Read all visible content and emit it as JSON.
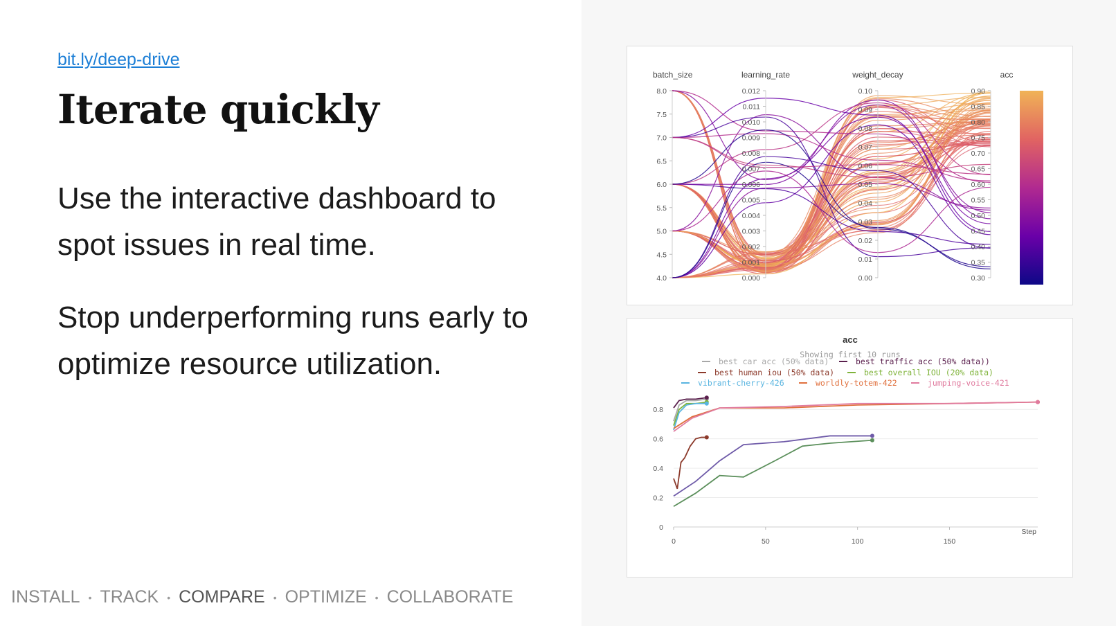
{
  "slide": {
    "link": "bit.ly/deep-drive",
    "title": "Iterate quickly",
    "paragraph1": "Use the interactive dashboard to spot issues in real time.",
    "paragraph2": "Stop underperforming runs early to optimize resource utilization."
  },
  "nav": {
    "items": [
      "INSTALL",
      "TRACK",
      "COMPARE",
      "OPTIMIZE",
      "COLLABORATE"
    ],
    "active": "COMPARE",
    "separator": "•"
  },
  "colors": {
    "link": "#1d7fd6",
    "highlight": "#fde7b8",
    "runs_orange": "#f0b356",
    "runs_purple": "#4a2f9e"
  },
  "chart_data": [
    {
      "type": "parallel-coordinates",
      "axes": [
        {
          "name": "batch_size",
          "ticks": [
            "8.0",
            "7.5",
            "7.0",
            "6.5",
            "6.0",
            "5.5",
            "5.0",
            "4.5",
            "4.0"
          ]
        },
        {
          "name": "learning_rate",
          "ticks": [
            "0.012",
            "0.011",
            "0.010",
            "0.009",
            "0.008",
            "0.007",
            "0.006",
            "0.005",
            "0.004",
            "0.003",
            "0.002",
            "0.001",
            "0.000"
          ]
        },
        {
          "name": "weight_decay",
          "ticks": [
            "0.10",
            "0.09",
            "0.08",
            "0.07",
            "0.06",
            "0.05",
            "0.04",
            "0.03",
            "0.02",
            "0.01",
            "0.00"
          ]
        },
        {
          "name": "acc",
          "ticks": [
            "0.90",
            "0.85",
            "0.80",
            "0.75",
            "0.70",
            "0.65",
            "0.60",
            "0.55",
            "0.50",
            "0.45",
            "0.40",
            "0.35",
            "0.30"
          ]
        }
      ],
      "colorscale": "plasma",
      "color_by": "acc",
      "color_range": [
        0.3,
        0.9
      ]
    },
    {
      "type": "line",
      "title": "acc",
      "subtitle": "Showing first 10 runs",
      "xlabel": "Step",
      "x_ticks": [
        "0",
        "50",
        "100",
        "150"
      ],
      "y_ticks": [
        "0",
        "0.2",
        "0.4",
        "0.6",
        "0.8"
      ],
      "xlim": [
        0,
        198
      ],
      "ylim": [
        0,
        0.9
      ],
      "grid": true,
      "legend_position": "top",
      "series": [
        {
          "name": "best car acc (50% data)",
          "color": "#a8a8a8",
          "x": [
            0,
            3,
            7,
            12,
            18
          ],
          "y": [
            0.72,
            0.83,
            0.86,
            0.86,
            0.87
          ]
        },
        {
          "name": "best traffic acc (50% data))",
          "color": "#5a1f4d",
          "x": [
            0,
            3,
            7,
            12,
            18
          ],
          "y": [
            0.81,
            0.86,
            0.87,
            0.87,
            0.88
          ]
        },
        {
          "name": "best human iou (50% data)",
          "color": "#8c3a2b",
          "x": [
            0,
            2,
            4,
            6,
            9,
            12,
            15,
            18
          ],
          "y": [
            0.33,
            0.26,
            0.44,
            0.47,
            0.55,
            0.6,
            0.61,
            0.61
          ]
        },
        {
          "name": "best overall IOU (20% data)",
          "color": "#7fb33a",
          "x": [
            0,
            3,
            7,
            12,
            18
          ],
          "y": [
            0.69,
            0.8,
            0.84,
            0.84,
            0.85
          ]
        },
        {
          "name": "vibrant-cherry-426",
          "color": "#58b4e0",
          "x": [
            0,
            3,
            7,
            12,
            18
          ],
          "y": [
            0.66,
            0.78,
            0.83,
            0.84,
            0.84
          ]
        },
        {
          "name": "worldly-totem-422",
          "color": "#e0703d",
          "x": [
            0,
            10,
            25,
            60,
            100,
            150,
            198
          ],
          "y": [
            0.67,
            0.75,
            0.81,
            0.81,
            0.83,
            0.84,
            0.85
          ]
        },
        {
          "name": "jumping-voice-421",
          "color": "#e07a9e",
          "x": [
            0,
            10,
            25,
            60,
            100,
            150,
            198
          ],
          "y": [
            0.65,
            0.74,
            0.81,
            0.82,
            0.84,
            0.84,
            0.85
          ]
        },
        {
          "name": "",
          "color": "#6e5aa8",
          "x": [
            0,
            12,
            25,
            38,
            60,
            85,
            108
          ],
          "y": [
            0.21,
            0.31,
            0.45,
            0.56,
            0.58,
            0.62,
            0.62
          ]
        },
        {
          "name": "",
          "color": "#5b8f5b",
          "x": [
            0,
            12,
            25,
            38,
            55,
            70,
            85,
            108
          ],
          "y": [
            0.14,
            0.23,
            0.35,
            0.34,
            0.45,
            0.55,
            0.57,
            0.59
          ]
        }
      ]
    }
  ]
}
